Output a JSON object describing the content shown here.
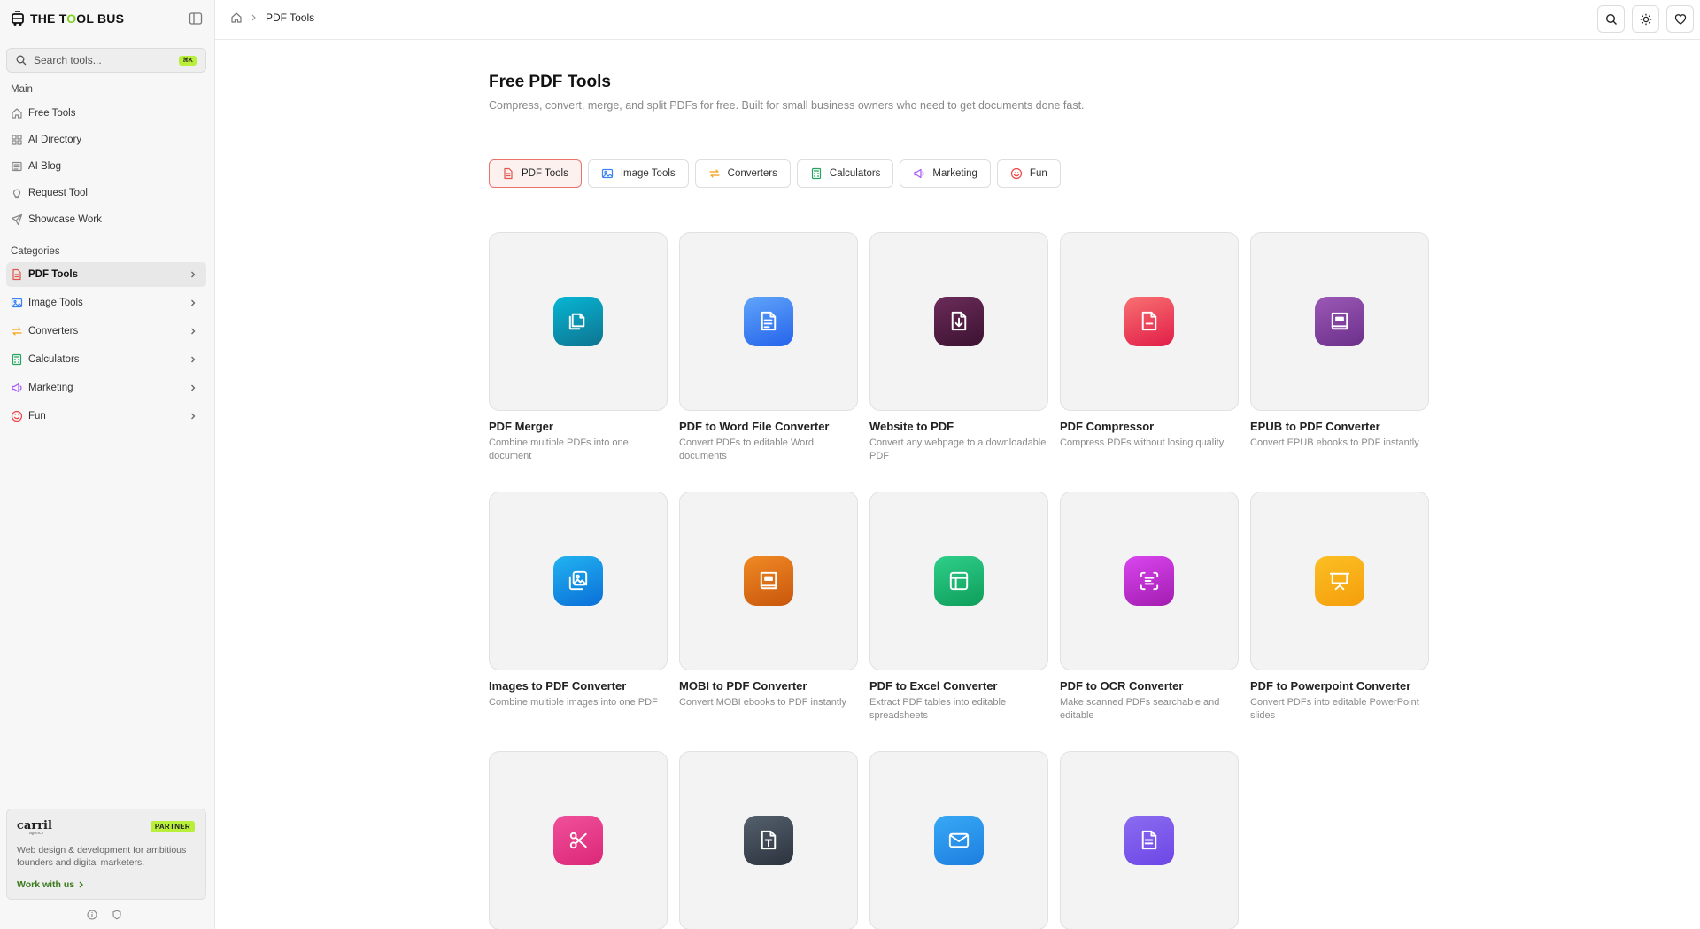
{
  "brand": {
    "name_pre": "THE T",
    "name_o1": "O",
    "name_post": "OL BUS"
  },
  "sidebar": {
    "search_placeholder": "Search tools...",
    "search_kbd": "⌘K",
    "main_label": "Main",
    "main_items": [
      {
        "label": "Free Tools",
        "icon": "home-icon"
      },
      {
        "label": "AI Directory",
        "icon": "grid-icon"
      },
      {
        "label": "AI Blog",
        "icon": "newspaper-icon"
      },
      {
        "label": "Request Tool",
        "icon": "lightbulb-icon"
      },
      {
        "label": "Showcase Work",
        "icon": "send-icon"
      }
    ],
    "categories_label": "Categories",
    "category_items": [
      {
        "label": "PDF Tools",
        "icon": "pdf-icon",
        "active": true,
        "color": "#e5534b"
      },
      {
        "label": "Image Tools",
        "icon": "image-icon",
        "color": "#3b82f6"
      },
      {
        "label": "Converters",
        "icon": "convert-icon",
        "color": "#f59e0b"
      },
      {
        "label": "Calculators",
        "icon": "calculator-icon",
        "color": "#22a55e"
      },
      {
        "label": "Marketing",
        "icon": "megaphone-icon",
        "color": "#a855f7"
      },
      {
        "label": "Fun",
        "icon": "smile-icon",
        "color": "#ef4444"
      }
    ],
    "partner": {
      "brand": "carril",
      "brand_sub": "agency",
      "badge": "PARTNER",
      "desc": "Web design & development for ambitious founders and digital marketers.",
      "link": "Work with us"
    }
  },
  "topbar": {
    "breadcrumb": "PDF Tools"
  },
  "main": {
    "title": "Free PDF Tools",
    "subtitle": "Compress, convert, merge, and split PDFs for free. Built for small business owners who need to get documents done fast.",
    "tabs": [
      {
        "label": "PDF Tools",
        "icon": "pdf-icon",
        "active": true,
        "color": "#e5534b"
      },
      {
        "label": "Image Tools",
        "icon": "image-icon",
        "color": "#3b82f6"
      },
      {
        "label": "Converters",
        "icon": "convert-icon",
        "color": "#f59e0b"
      },
      {
        "label": "Calculators",
        "icon": "calculator-icon",
        "color": "#22a55e"
      },
      {
        "label": "Marketing",
        "icon": "megaphone-icon",
        "color": "#a855f7"
      },
      {
        "label": "Fun",
        "icon": "smile-icon",
        "color": "#ef4444"
      }
    ],
    "tools": [
      {
        "name": "PDF Merger",
        "desc": "Combine multiple PDFs into one document",
        "icon": "copy-icon",
        "c1": "#06b6d4",
        "c2": "#0e7490"
      },
      {
        "name": "PDF to Word File Converter",
        "desc": "Convert PDFs to editable Word documents",
        "icon": "document-icon",
        "c1": "#60a5fa",
        "c2": "#2563eb"
      },
      {
        "name": "Website to PDF",
        "desc": "Convert any webpage to a downloadable PDF",
        "icon": "file-download-icon",
        "c1": "#6b2c5a",
        "c2": "#3b1230"
      },
      {
        "name": "PDF Compressor",
        "desc": "Compress PDFs without losing quality",
        "icon": "file-minus-icon",
        "c1": "#f87171",
        "c2": "#e11d48"
      },
      {
        "name": "EPUB to PDF Converter",
        "desc": "Convert EPUB ebooks to PDF instantly",
        "icon": "book-pdf-icon",
        "c1": "#9b59b6",
        "c2": "#6b2f8a"
      },
      {
        "name": "Images to PDF Converter",
        "desc": "Combine multiple images into one PDF",
        "icon": "images-icon",
        "c1": "#22b3f0",
        "c2": "#0a6fd8"
      },
      {
        "name": "MOBI to PDF Converter",
        "desc": "Convert MOBI ebooks to PDF instantly",
        "icon": "book-pdf-icon",
        "c1": "#f08a24",
        "c2": "#c8560c"
      },
      {
        "name": "PDF to Excel Converter",
        "desc": "Extract PDF tables into editable spreadsheets",
        "icon": "table-icon",
        "c1": "#2ecf8a",
        "c2": "#0f9d5b"
      },
      {
        "name": "PDF to OCR Converter",
        "desc": "Make scanned PDFs searchable and editable",
        "icon": "scan-text-icon",
        "c1": "#d946ef",
        "c2": "#a21caf"
      },
      {
        "name": "PDF to Powerpoint Converter",
        "desc": "Convert PDFs into editable PowerPoint slides",
        "icon": "presentation-icon",
        "c1": "#fbbf24",
        "c2": "#f59e0b"
      },
      {
        "name": "",
        "desc": "",
        "icon": "scissors-icon",
        "c1": "#f0509a",
        "c2": "#db2777"
      },
      {
        "name": "",
        "desc": "",
        "icon": "file-text-t-icon",
        "c1": "#55606e",
        "c2": "#2b333d"
      },
      {
        "name": "",
        "desc": "",
        "icon": "mail-icon",
        "c1": "#38a9f5",
        "c2": "#1d7ee0"
      },
      {
        "name": "",
        "desc": "",
        "icon": "file-lines-icon",
        "c1": "#8b6cf0",
        "c2": "#6d46e6"
      }
    ]
  }
}
